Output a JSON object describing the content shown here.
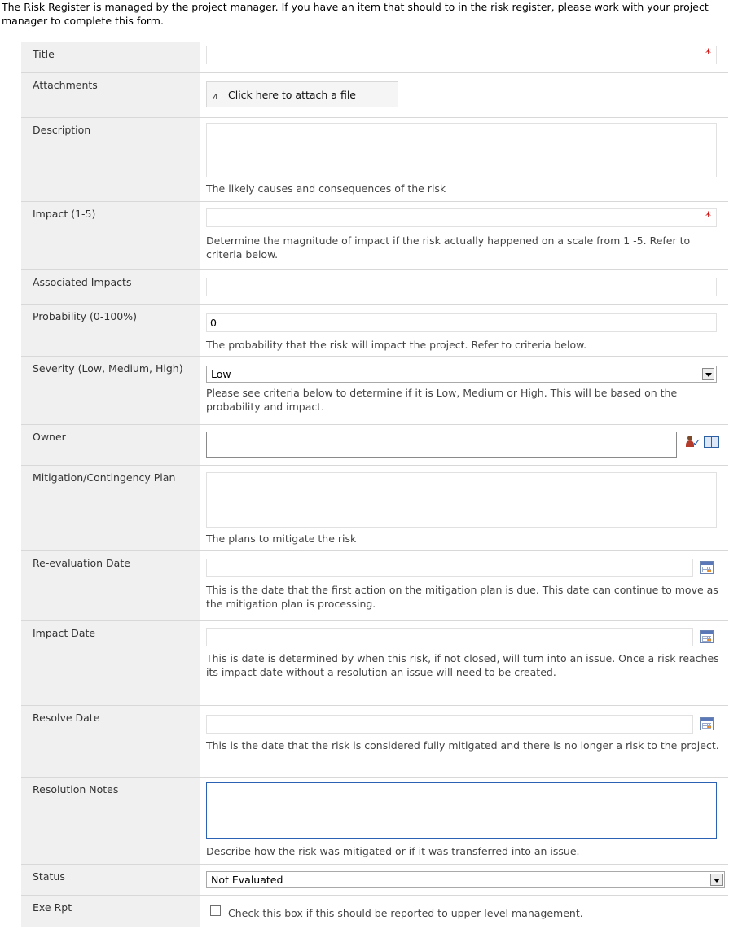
{
  "intro": "The Risk Register is managed by the project manager. If you have an item that should to in the risk register, please work with your project manager to complete this form.",
  "required_marker": "*",
  "fields": {
    "title": {
      "label": "Title",
      "value": ""
    },
    "attachments": {
      "label": "Attachments",
      "button": "Click here to attach a file",
      "icon": "paperclip-icon"
    },
    "description": {
      "label": "Description",
      "value": "",
      "hint": "The likely causes and consequences of the risk"
    },
    "impact": {
      "label": "Impact (1-5)",
      "value": "",
      "hint": "Determine the magnitude of impact if the risk actually happened on a scale from 1 -5. Refer to criteria below."
    },
    "associated_impacts": {
      "label": "Associated Impacts",
      "value": ""
    },
    "probability": {
      "label": "Probability (0-100%)",
      "value": "0",
      "hint": "The probability that the risk will impact the project. Refer to criteria below."
    },
    "severity": {
      "label": "Severity (Low, Medium, High)",
      "selected": "Low",
      "hint": "Please see criteria below to determine if it is Low, Medium or High. This will be based on the probability and impact."
    },
    "owner": {
      "label": "Owner",
      "value": "",
      "icons": [
        "check-names-icon",
        "address-book-icon"
      ]
    },
    "mitigation": {
      "label": "Mitigation/Contingency Plan",
      "value": "",
      "hint": "The plans to mitigate the risk"
    },
    "reevaluation_date": {
      "label": "Re-evaluation Date",
      "value": "",
      "hint": "This is the date that the first action on the mitigation plan is due. This date can continue to move as the mitigation plan is processing.",
      "icon": "calendar-icon"
    },
    "impact_date": {
      "label": "Impact Date",
      "value": "",
      "hint": "This is date is determined by when this risk, if not closed, will turn into an issue. Once a risk reaches its impact date without a resolution an issue will need to be created.",
      "icon": "calendar-icon"
    },
    "resolve_date": {
      "label": "Resolve Date",
      "value": "",
      "hint": "This is the date that the risk is considered fully mitigated and there is no longer a risk to the project.",
      "icon": "calendar-icon"
    },
    "resolution_notes": {
      "label": "Resolution Notes",
      "value": "",
      "hint": "Describe how the risk was mitigated or if it was transferred into an issue."
    },
    "status": {
      "label": "Status",
      "selected": "Not Evaluated"
    },
    "exe_rpt": {
      "label": "Exe Rpt",
      "checked": false,
      "hint": "Check this box if this should be reported to upper level management."
    }
  },
  "colors": {
    "label_background": "#f0f0f0",
    "required": "#cc0000",
    "focus_border": "#2b62b3"
  }
}
